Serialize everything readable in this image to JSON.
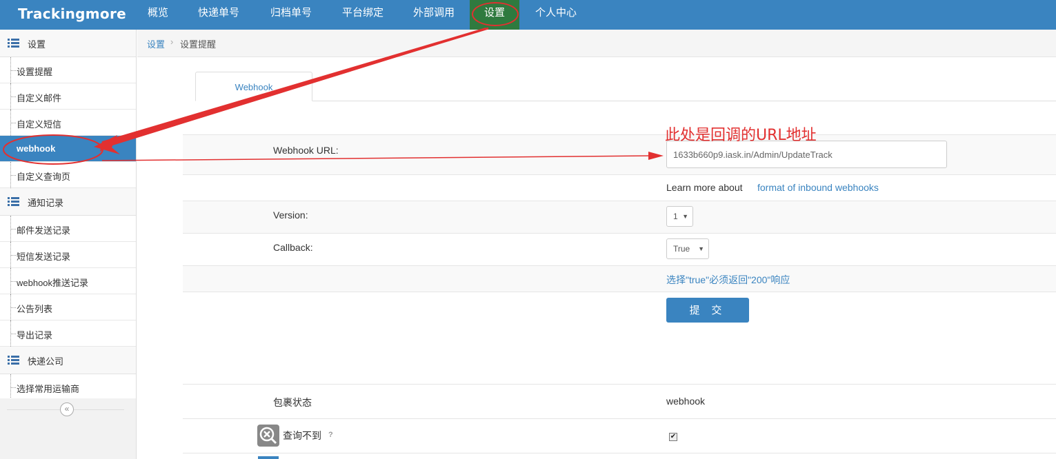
{
  "brand": "Trackingmore",
  "nav": {
    "items": [
      "概览",
      "快递单号",
      "归档单号",
      "平台绑定",
      "外部调用",
      "设置",
      "个人中心"
    ],
    "active": "设置"
  },
  "sidebar": {
    "group_settings": "设置",
    "item_reminder": "设置提醒",
    "item_custom_email": "自定义邮件",
    "item_custom_sms": "自定义短信",
    "item_webhook": "webhook",
    "item_custom_query": "自定义查询页",
    "group_notify": "通知记录",
    "item_email_log": "邮件发送记录",
    "item_sms_log": "短信发送记录",
    "item_webhook_log": "webhook推送记录",
    "item_notice": "公告列表",
    "item_export": "导出记录",
    "group_carrier": "快递公司",
    "item_carrier_select": "选择常用运输商",
    "collapse_symbol": "«"
  },
  "breadcrumb": {
    "root": "设置",
    "separator": "›",
    "current": "设置提醒"
  },
  "tabs": {
    "webhook": "Webhook"
  },
  "annotation": "此处是回调的URL地址",
  "form": {
    "url_label": "Webhook URL:",
    "url_value": "1633b660p9.iask.in/Admin/UpdateTrack",
    "learn_text": "Learn more about",
    "learn_link": "format of inbound webhooks",
    "version_label": "Version:",
    "version_value": "1",
    "callback_label": "Callback:",
    "callback_value": "True",
    "hint": "选择\"true\"必须返回\"200\"响应",
    "submit": "提 交"
  },
  "status_table": {
    "header_label": "包裹状态",
    "header_value": "webhook",
    "row1_label": "查询不到",
    "row1_help": "?",
    "row1_checked": true
  },
  "colors": {
    "accent": "#3a84c0",
    "annotation": "#e23030",
    "active_nav": "#2f7a3f"
  },
  "icons": {
    "list": "list-icon",
    "caret": "caret-down-icon",
    "query": "query-not-found-icon",
    "check": "checkmark-icon"
  }
}
